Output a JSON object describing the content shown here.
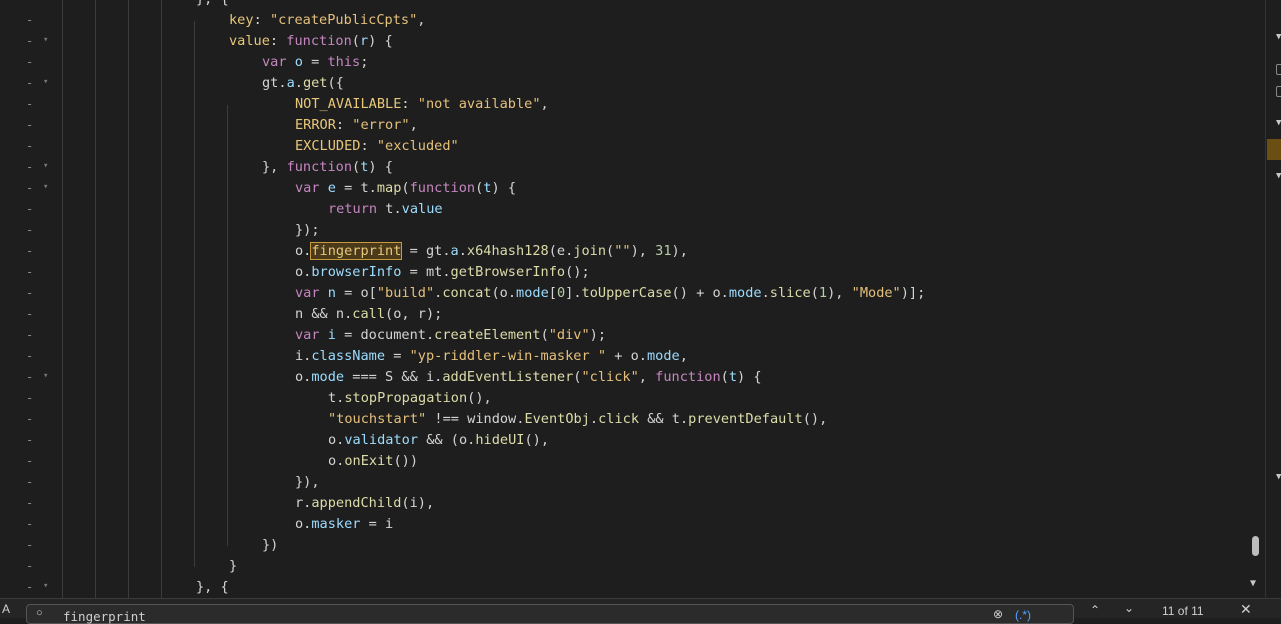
{
  "editor": {
    "lines": [
      {
        "marker": "-",
        "fold": "",
        "indent": 4,
        "tokens": [
          [
            "d",
            "}, {"
          ]
        ]
      },
      {
        "marker": "-",
        "fold": "",
        "indent": 5,
        "tokens": [
          [
            "p",
            "key"
          ],
          [
            "d",
            ": "
          ],
          [
            "s",
            "\"createPublicCpts\""
          ],
          [
            "d",
            ","
          ]
        ]
      },
      {
        "marker": "-",
        "fold": "▾",
        "indent": 5,
        "tokens": [
          [
            "p",
            "value"
          ],
          [
            "d",
            ": "
          ],
          [
            "k",
            "function"
          ],
          [
            "d",
            "("
          ],
          [
            "v",
            "r"
          ],
          [
            "d",
            ") {"
          ]
        ]
      },
      {
        "marker": "-",
        "fold": "",
        "indent": 6,
        "tokens": [
          [
            "k",
            "var"
          ],
          [
            "d",
            " "
          ],
          [
            "v",
            "o"
          ],
          [
            "d",
            " = "
          ],
          [
            "k",
            "this"
          ],
          [
            "d",
            ";"
          ]
        ]
      },
      {
        "marker": "-",
        "fold": "▾",
        "indent": 6,
        "tokens": [
          [
            "d",
            "gt."
          ],
          [
            "v",
            "a"
          ],
          [
            "d",
            "."
          ],
          [
            "f",
            "get"
          ],
          [
            "d",
            "({"
          ]
        ]
      },
      {
        "marker": "-",
        "fold": "",
        "indent": 7,
        "tokens": [
          [
            "p",
            "NOT_AVAILABLE"
          ],
          [
            "d",
            ": "
          ],
          [
            "s",
            "\"not available\""
          ],
          [
            "d",
            ","
          ]
        ]
      },
      {
        "marker": "-",
        "fold": "",
        "indent": 7,
        "tokens": [
          [
            "p",
            "ERROR"
          ],
          [
            "d",
            ": "
          ],
          [
            "s",
            "\"error\""
          ],
          [
            "d",
            ","
          ]
        ]
      },
      {
        "marker": "-",
        "fold": "",
        "indent": 7,
        "tokens": [
          [
            "p",
            "EXCLUDED"
          ],
          [
            "d",
            ": "
          ],
          [
            "s",
            "\"excluded\""
          ]
        ]
      },
      {
        "marker": "-",
        "fold": "▾",
        "indent": 6,
        "tokens": [
          [
            "d",
            "}, "
          ],
          [
            "k",
            "function"
          ],
          [
            "d",
            "("
          ],
          [
            "v",
            "t"
          ],
          [
            "d",
            ") {"
          ]
        ]
      },
      {
        "marker": "-",
        "fold": "▾",
        "indent": 7,
        "tokens": [
          [
            "k",
            "var"
          ],
          [
            "d",
            " "
          ],
          [
            "v",
            "e"
          ],
          [
            "d",
            " = t."
          ],
          [
            "f",
            "map"
          ],
          [
            "d",
            "("
          ],
          [
            "k",
            "function"
          ],
          [
            "d",
            "("
          ],
          [
            "v",
            "t"
          ],
          [
            "d",
            ") {"
          ]
        ]
      },
      {
        "marker": "-",
        "fold": "",
        "indent": 8,
        "tokens": [
          [
            "k",
            "return"
          ],
          [
            "d",
            " t."
          ],
          [
            "v",
            "value"
          ]
        ]
      },
      {
        "marker": "-",
        "fold": "",
        "indent": 7,
        "tokens": [
          [
            "d",
            "});"
          ]
        ]
      },
      {
        "marker": "-",
        "fold": "",
        "indent": 7,
        "tokens": [
          [
            "d",
            "o."
          ],
          [
            "hl",
            "fingerprint"
          ],
          [
            "d",
            " = gt."
          ],
          [
            "v",
            "a"
          ],
          [
            "d",
            "."
          ],
          [
            "f",
            "x64hash128"
          ],
          [
            "d",
            "(e."
          ],
          [
            "f",
            "join"
          ],
          [
            "d",
            "("
          ],
          [
            "s",
            "\"\""
          ],
          [
            "d",
            "), "
          ],
          [
            "n",
            "31"
          ],
          [
            "d",
            "),"
          ]
        ]
      },
      {
        "marker": "-",
        "fold": "",
        "indent": 7,
        "tokens": [
          [
            "d",
            "o."
          ],
          [
            "v",
            "browserInfo"
          ],
          [
            "d",
            " = mt."
          ],
          [
            "f",
            "getBrowserInfo"
          ],
          [
            "d",
            "();"
          ]
        ]
      },
      {
        "marker": "-",
        "fold": "",
        "indent": 7,
        "tokens": [
          [
            "k",
            "var"
          ],
          [
            "d",
            " "
          ],
          [
            "v",
            "n"
          ],
          [
            "d",
            " = o["
          ],
          [
            "s",
            "\"build\""
          ],
          [
            "d",
            "."
          ],
          [
            "f",
            "concat"
          ],
          [
            "d",
            "(o."
          ],
          [
            "v",
            "mode"
          ],
          [
            "d",
            "["
          ],
          [
            "n",
            "0"
          ],
          [
            "d",
            "]."
          ],
          [
            "f",
            "toUpperCase"
          ],
          [
            "d",
            "() + o."
          ],
          [
            "v",
            "mode"
          ],
          [
            "d",
            "."
          ],
          [
            "f",
            "slice"
          ],
          [
            "d",
            "("
          ],
          [
            "n",
            "1"
          ],
          [
            "d",
            "), "
          ],
          [
            "s",
            "\"Mode\""
          ],
          [
            "d",
            ")];"
          ]
        ]
      },
      {
        "marker": "-",
        "fold": "",
        "indent": 7,
        "tokens": [
          [
            "d",
            "n && n."
          ],
          [
            "f",
            "call"
          ],
          [
            "d",
            "(o, r);"
          ]
        ]
      },
      {
        "marker": "-",
        "fold": "",
        "indent": 7,
        "tokens": [
          [
            "k",
            "var"
          ],
          [
            "d",
            " "
          ],
          [
            "v",
            "i"
          ],
          [
            "d",
            " = document."
          ],
          [
            "f",
            "createElement"
          ],
          [
            "d",
            "("
          ],
          [
            "s",
            "\"div\""
          ],
          [
            "d",
            ");"
          ]
        ]
      },
      {
        "marker": "-",
        "fold": "",
        "indent": 7,
        "tokens": [
          [
            "d",
            "i."
          ],
          [
            "v",
            "className"
          ],
          [
            "d",
            " = "
          ],
          [
            "s",
            "\"yp-riddler-win-masker \""
          ],
          [
            "d",
            " + o."
          ],
          [
            "v",
            "mode"
          ],
          [
            "d",
            ","
          ]
        ]
      },
      {
        "marker": "-",
        "fold": "▾",
        "indent": 7,
        "tokens": [
          [
            "d",
            "o."
          ],
          [
            "v",
            "mode"
          ],
          [
            "d",
            " === S && i."
          ],
          [
            "f",
            "addEventListener"
          ],
          [
            "d",
            "("
          ],
          [
            "s",
            "\"click\""
          ],
          [
            "d",
            ", "
          ],
          [
            "k",
            "function"
          ],
          [
            "d",
            "("
          ],
          [
            "v",
            "t"
          ],
          [
            "d",
            ") {"
          ]
        ]
      },
      {
        "marker": "-",
        "fold": "",
        "indent": 8,
        "tokens": [
          [
            "d",
            "t."
          ],
          [
            "f",
            "stopPropagation"
          ],
          [
            "d",
            "(),"
          ]
        ]
      },
      {
        "marker": "-",
        "fold": "",
        "indent": 8,
        "tokens": [
          [
            "s",
            "\"touchstart\""
          ],
          [
            "d",
            " !== window."
          ],
          [
            "f",
            "EventObj"
          ],
          [
            "d",
            "."
          ],
          [
            "f",
            "click"
          ],
          [
            "d",
            " && t."
          ],
          [
            "f",
            "preventDefault"
          ],
          [
            "d",
            "(),"
          ]
        ]
      },
      {
        "marker": "-",
        "fold": "",
        "indent": 8,
        "tokens": [
          [
            "d",
            "o."
          ],
          [
            "v",
            "validator"
          ],
          [
            "d",
            " && (o."
          ],
          [
            "f",
            "hideUI"
          ],
          [
            "d",
            "(),"
          ]
        ]
      },
      {
        "marker": "-",
        "fold": "",
        "indent": 8,
        "tokens": [
          [
            "d",
            "o."
          ],
          [
            "f",
            "onExit"
          ],
          [
            "d",
            "())"
          ]
        ]
      },
      {
        "marker": "-",
        "fold": "",
        "indent": 7,
        "tokens": [
          [
            "d",
            "}),"
          ]
        ]
      },
      {
        "marker": "-",
        "fold": "",
        "indent": 7,
        "tokens": [
          [
            "d",
            "r."
          ],
          [
            "f",
            "appendChild"
          ],
          [
            "d",
            "(i),"
          ]
        ]
      },
      {
        "marker": "-",
        "fold": "",
        "indent": 7,
        "tokens": [
          [
            "d",
            "o."
          ],
          [
            "v",
            "masker"
          ],
          [
            "d",
            " = i"
          ]
        ]
      },
      {
        "marker": "-",
        "fold": "",
        "indent": 6,
        "tokens": [
          [
            "d",
            "})"
          ]
        ]
      },
      {
        "marker": "-",
        "fold": "",
        "indent": 5,
        "tokens": [
          [
            "d",
            "}"
          ]
        ]
      },
      {
        "marker": "-",
        "fold": "▾",
        "indent": 4,
        "tokens": [
          [
            "d",
            "}, {"
          ]
        ]
      }
    ]
  },
  "search": {
    "query": "fingerprint",
    "regex_label": "(.*)",
    "match_count": "11 of 11",
    "toggle_label": "A"
  },
  "icons": {
    "search": "search-icon",
    "clear": "clear-icon",
    "prev": "chevron-up-icon",
    "next": "chevron-down-icon",
    "close": "close-icon"
  }
}
